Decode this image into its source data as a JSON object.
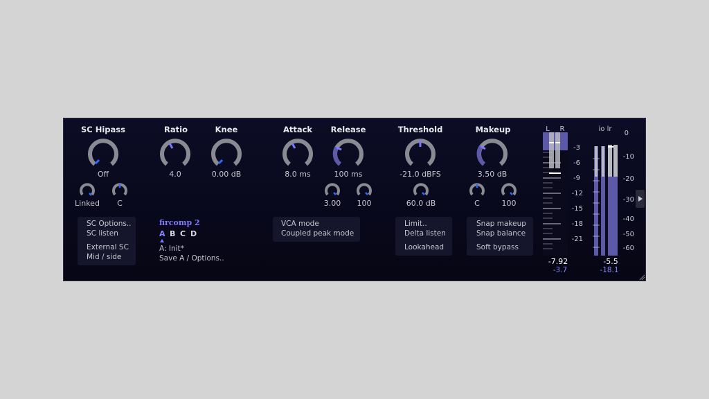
{
  "plugin": "fircomp 2",
  "knobs": {
    "sc_hipass": {
      "label": "SC Hipass",
      "value": "Off"
    },
    "ratio": {
      "label": "Ratio",
      "value": "4.0"
    },
    "knee": {
      "label": "Knee",
      "value": "0.00 dB"
    },
    "attack": {
      "label": "Attack",
      "value": "8.0 ms"
    },
    "release": {
      "label": "Release",
      "value": "100 ms"
    },
    "threshold": {
      "label": "Threshold",
      "value": "-21.0 dBFS"
    },
    "makeup": {
      "label": "Makeup",
      "value": "3.50 dB"
    }
  },
  "small_knobs": {
    "linked": "Linked",
    "c_left": "C",
    "release_a": "3.00",
    "release_b": "100",
    "threshold_sub": "60.0 dB",
    "makeup_c": "C",
    "makeup_100": "100"
  },
  "sc_box": {
    "options": "SC Options..",
    "listen": "SC listen",
    "external": "External SC",
    "midside": "Mid / side"
  },
  "preset": {
    "name": "fircomp 2",
    "slots": [
      "A",
      "B",
      "C",
      "D"
    ],
    "active_slot": "A",
    "current": "A: Init*",
    "save": "Save A / Options.."
  },
  "mode_box": {
    "vca": "VCA mode",
    "coupled": "Coupled peak mode"
  },
  "limit_box": {
    "limit": "Limit..",
    "delta": "Delta listen",
    "lookahead": "Lookahead"
  },
  "snap_box": {
    "makeup": "Snap makeup",
    "balance": "Snap balance",
    "bypass": "Soft bypass"
  },
  "gr_meter": {
    "channels": [
      "L",
      "R"
    ],
    "ticks": [
      "-3",
      "-6",
      "-9",
      "-12",
      "-15",
      "-18",
      "-21"
    ],
    "value": "-7.92",
    "sub_value": "-3.7"
  },
  "io_meter": {
    "label": "io lr",
    "ticks": [
      "0",
      "-10",
      "-20",
      "-30",
      "-40",
      "-50",
      "-60"
    ],
    "value": "-5.5",
    "sub_value": "-18.1"
  },
  "colors": {
    "accent": "#7c78ff",
    "knob_track": "#8a8a92",
    "knob_pointer_blue": "#2a6cff",
    "meter_fill": "#5c5aa8"
  }
}
